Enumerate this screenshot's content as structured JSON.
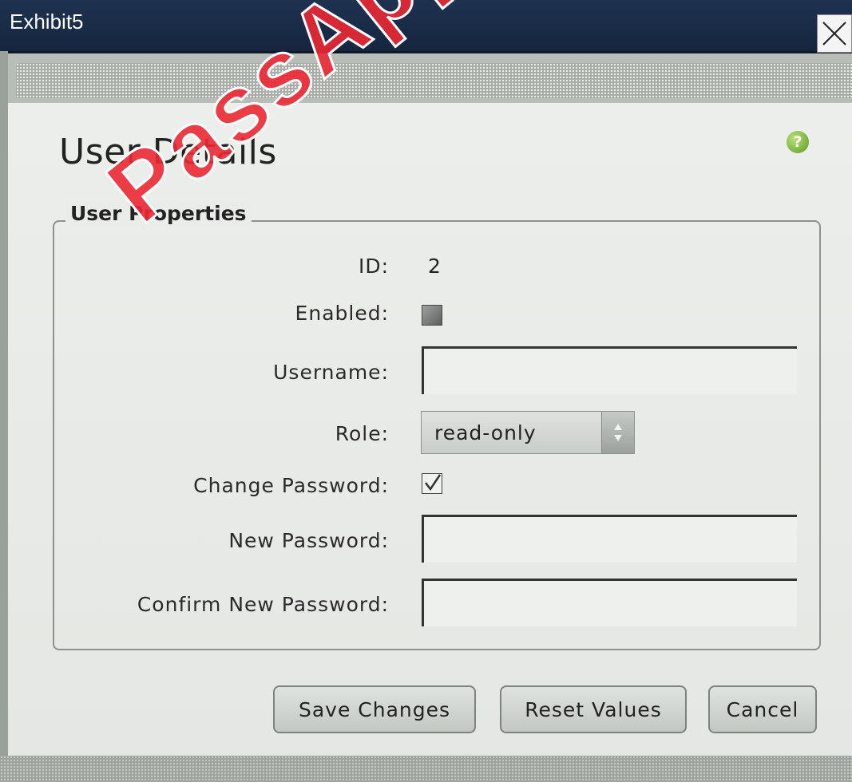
{
  "window": {
    "title": "Exhibit5",
    "close_icon": "close-icon"
  },
  "dialog": {
    "heading": "User Details",
    "help_icon": "help-icon",
    "help_glyph": "?",
    "group_label": "User Properties",
    "fields": {
      "id_label": "ID:",
      "id_value": "2",
      "enabled_label": "Enabled:",
      "enabled_checked": false,
      "username_label": "Username:",
      "username_value": "",
      "role_label": "Role:",
      "role_value": "read-only",
      "change_password_label": "Change Password:",
      "change_password_checked": true,
      "new_password_label": "New Password:",
      "new_password_value": "",
      "confirm_password_label": "Confirm New Password:",
      "confirm_password_value": ""
    },
    "buttons": {
      "save": "Save Changes",
      "reset": "Reset Values",
      "cancel": "Cancel"
    }
  },
  "watermark": "PassApply",
  "colors": {
    "titlebar": "#1e3250",
    "watermark": "#ec2834",
    "help_icon": "#6aa82a"
  }
}
